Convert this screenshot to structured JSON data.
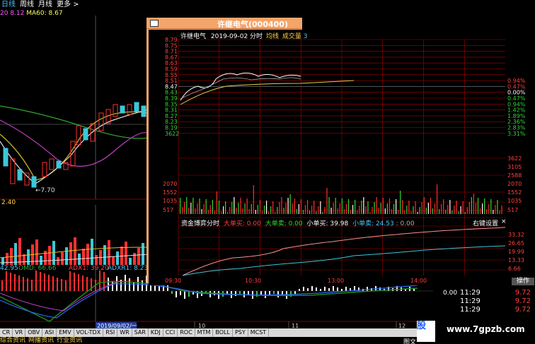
{
  "tabs": {
    "daily": "日线",
    "weekly": "周线",
    "monthly": "月线",
    "more": "更多 >"
  },
  "ma_row": {
    "ma_prefix": "20",
    "ma_val": "8.12",
    "ma60_label": "MA60:",
    "ma60_val": "8.67"
  },
  "popup": {
    "title": "许继电气(000400)",
    "header_name": "许继电气",
    "header_date": "2019-09-02 分时",
    "header_avg": "均线",
    "header_vol": "成交量",
    "header_vol_val": "3",
    "settings": "右键设置",
    "close": "×",
    "operate": "操作",
    "game_label": "资金博弈分时",
    "game_big_buy": "大单买: 0.00",
    "game_big_sell": "大单卖: 0.00",
    "game_small_buy": "小单买: 39.98",
    "game_small_sell": "小单卖: 24.53",
    "game_extra": ": 0.00"
  },
  "price_left": [
    "8.79",
    "8.75",
    "8.71",
    "8.67",
    "8.63",
    "8.59",
    "8.55",
    "8.51",
    "8.47",
    "8.43",
    "8.39",
    "8.35",
    "8.31",
    "8.27",
    "8.23",
    "8.19",
    "3622"
  ],
  "price_right_pct": [
    "0.94%",
    "0.47%",
    "0.00%",
    "0.47%",
    "0.94%",
    "1.42%",
    "1.89%",
    "2.36%",
    "2.83%",
    "3.31%"
  ],
  "vol_right": [
    "3622",
    "3105",
    "2588",
    "2070",
    "1552",
    "1035",
    "517"
  ],
  "vol_left": [
    "2070",
    "1552",
    "1035",
    "517"
  ],
  "game_right": [
    "33.32",
    "26.65",
    "19.99",
    "13.33",
    "6.66"
  ],
  "time_axis": [
    "09:30",
    "10:30",
    "13:00",
    "14:00"
  ],
  "left_chart": {
    "low_label": "←7.70",
    "price_label": "2.40",
    "date_label": "2019/09/02/一",
    "day_10": "10",
    "day_11": "11",
    "day_12": "12",
    "ind_left": "42.95",
    "ind_omd": "OMD: 66.66",
    "ind_adx": "ADX1: 39.20",
    "ind_adxr": "ADXR1: 8.23"
  },
  "right_ticks": [
    {
      "time": "11:29",
      "price": "9.72"
    },
    {
      "time": "11:29",
      "price": "9.72"
    },
    {
      "time": "11:29",
      "price": "9.72"
    }
  ],
  "right_pct_label": "0.00",
  "bottom_toolbar": [
    "CR",
    "VR",
    "OBV",
    "ASI",
    "EMV",
    "VOL-TDX",
    "RSI",
    "WR",
    "SAR",
    "KDJ",
    "CCI",
    "ROC",
    "MTM",
    "BOLL",
    "PSY",
    "MCST"
  ],
  "bottom_tabs": [
    "综合资讯",
    "网播资讯",
    "行业资讯"
  ],
  "footer_label": "图文",
  "watermark": {
    "logo": "股",
    "url": "www.7gpzb.com"
  }
}
